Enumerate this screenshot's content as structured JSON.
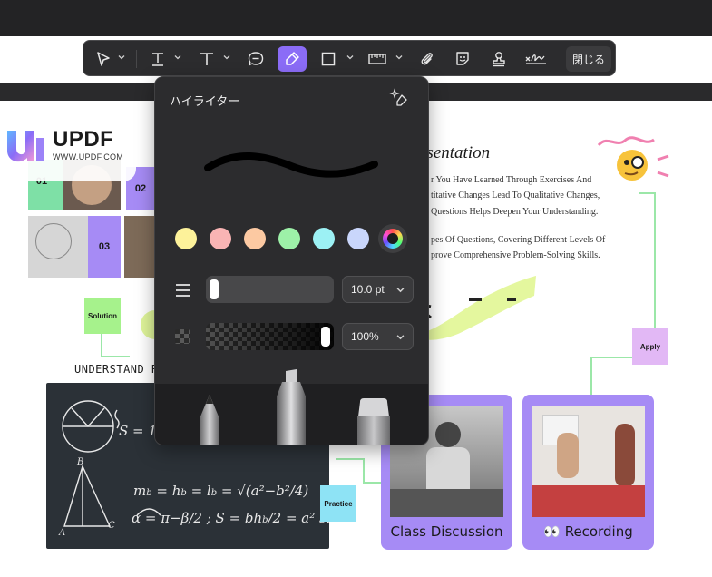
{
  "toolbar": {
    "tools": [
      {
        "name": "select-tool",
        "icon": "cursor-arrow-icon"
      },
      {
        "name": "text-underline-tool",
        "icon": "text-underline-icon"
      },
      {
        "name": "text-tool",
        "icon": "text-icon"
      },
      {
        "name": "comment-tool",
        "icon": "speech-bubble-icon"
      },
      {
        "name": "highlighter-tool",
        "icon": "highlighter-icon",
        "active": true
      },
      {
        "name": "shape-tool",
        "icon": "rectangle-icon"
      },
      {
        "name": "measure-tool",
        "icon": "ruler-icon"
      },
      {
        "name": "attachment-tool",
        "icon": "paperclip-icon"
      },
      {
        "name": "sticker-tool",
        "icon": "sticker-icon"
      },
      {
        "name": "stamp-tool",
        "icon": "stamp-icon"
      },
      {
        "name": "signature-tool",
        "icon": "signature-icon"
      }
    ],
    "close_label": "閉じる"
  },
  "popover": {
    "title": "ハイライター",
    "colors": [
      "#fdf29a",
      "#f9b4b4",
      "#fcc9a2",
      "#9df1a8",
      "#9cf1f4",
      "#c9d6fb"
    ],
    "thickness_value": "10.0 pt",
    "opacity_value": "100%",
    "thickness_fraction": 0.0,
    "opacity_fraction": 1.0
  },
  "document": {
    "logo_text": "UPDF",
    "logo_url": "WWW.UPDF.COM",
    "box_02": "02",
    "box_03": "03",
    "box_01": "01",
    "solution_label": "Solution",
    "apply_label": "Apply",
    "practice_label": "Practice",
    "understand_label": "UNDERSTAND R",
    "presentation_title": "esentation",
    "presentation_lines": [
      "r You Have Learned Through Exercises And",
      "titative Changes Lead To Qualitative Changes,",
      "Questions Helps Deepen Your Understanding.",
      "pes Of Questions, Covering Different Levels Of",
      "prove Comprehensive Problem-Solving Skills."
    ],
    "card1_caption": "Class Discussion",
    "card2_caption": "Recording"
  }
}
